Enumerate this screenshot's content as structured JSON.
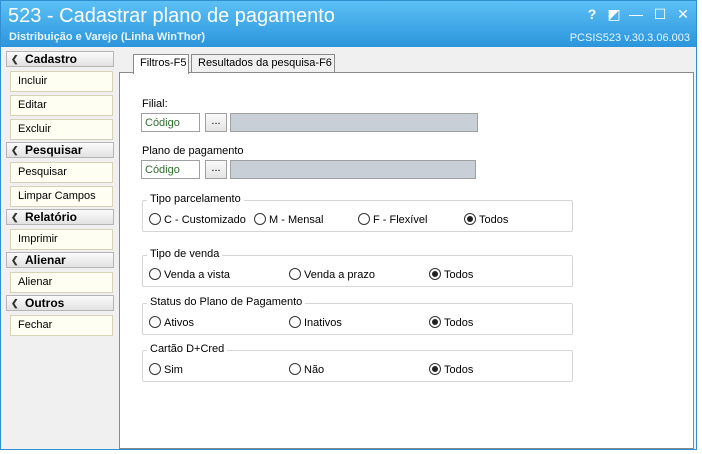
{
  "title": {
    "main": "523 - Cadastrar plano de pagamento",
    "subtitle": "Distribuição e Varejo (Linha WinThor)",
    "version": "PCSIS523  v.30.3.06.003",
    "help_symbol": "?",
    "restore_symbol": "◩",
    "minimize_symbol": "—",
    "maximize_symbol": "☐",
    "close_symbol": "✕"
  },
  "sidebar": {
    "chevron_symbol": "❮",
    "cadastro": {
      "header": "Cadastro",
      "items": [
        "Incluir",
        "Editar",
        "Excluir"
      ]
    },
    "pesquisar": {
      "header": "Pesquisar",
      "items": [
        "Pesquisar",
        "Limpar Campos"
      ]
    },
    "relatorio": {
      "header": "Relatório",
      "items": [
        "Imprimir"
      ]
    },
    "alienar": {
      "header": "Alienar",
      "items": [
        "Alienar"
      ]
    },
    "outros": {
      "header": "Outros",
      "items": [
        "Fechar"
      ]
    }
  },
  "tabs": [
    "Filtros-F5",
    "Resultados da pesquisa-F6"
  ],
  "filters": {
    "filial": {
      "label": "Filial:",
      "placeholder": "Código",
      "lookup_label": "..."
    },
    "plano": {
      "label": "Plano de pagamento",
      "placeholder": "Código",
      "lookup_label": "..."
    },
    "tipo_parcelamento": {
      "title": "Tipo parcelamento",
      "options": [
        "C - Customizado",
        "M - Mensal",
        "F - Flexível",
        "Todos"
      ],
      "selected": "Todos"
    },
    "tipo_venda": {
      "title": "Tipo de venda",
      "options": [
        "Venda a vista",
        "Venda a prazo",
        "Todos"
      ],
      "selected": "Todos"
    },
    "status_plano": {
      "title": "Status do Plano de Pagamento",
      "options": [
        "Ativos",
        "Inativos",
        "Todos"
      ],
      "selected": "Todos"
    },
    "cartao": {
      "title": "Cartão D+Cred",
      "options": [
        "Sim",
        "Não",
        "Todos"
      ],
      "selected": "Todos"
    }
  },
  "colors": {
    "titlebar_top": "#5cc0f5",
    "titlebar_bottom": "#2b95dc",
    "placeholder_green": "#2e6f2e",
    "description_box": "#c9cfd6"
  }
}
